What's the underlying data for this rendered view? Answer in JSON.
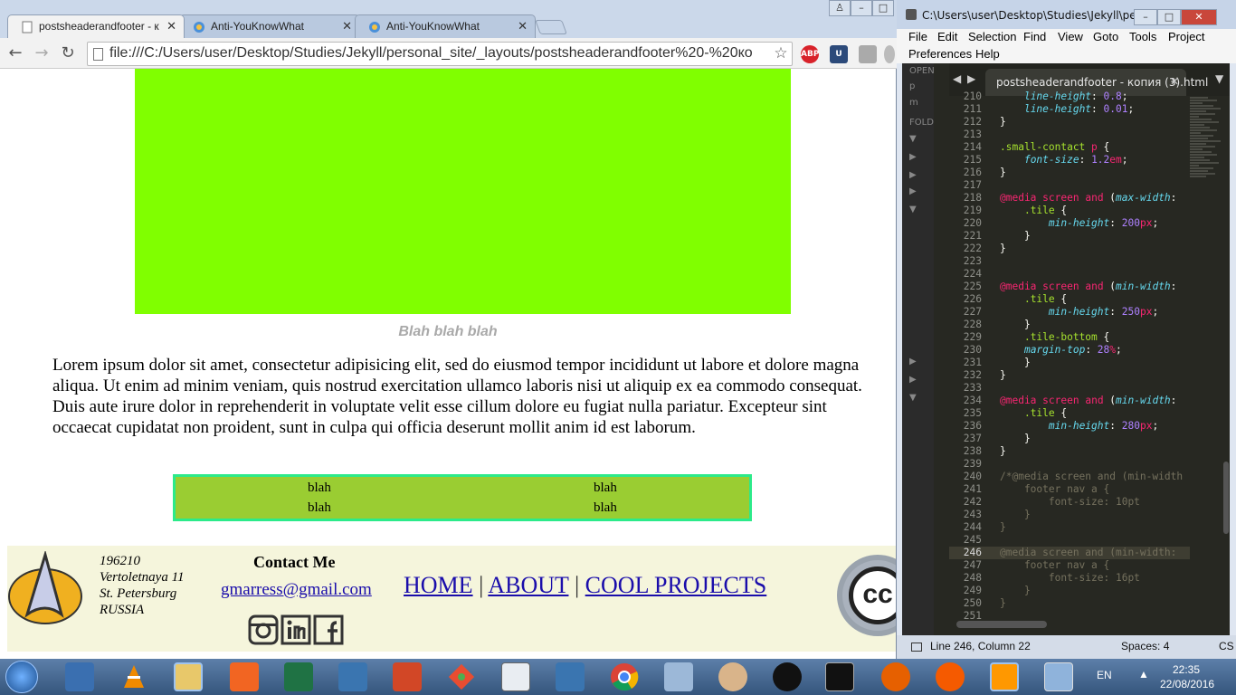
{
  "chrome": {
    "tabs": [
      {
        "title": "postsheaderandfooter - к",
        "close": "✕"
      },
      {
        "title": "Anti-YouKnowWhat",
        "close": "✕"
      },
      {
        "title": "Anti-YouKnowWhat",
        "close": "✕"
      }
    ],
    "address": "file:///C:/Users/user/Desktop/Studies/Jekyll/personal_site/_layouts/postsheaderandfooter%20-%20ко",
    "ext_abp": "ABP",
    "ext_u": "U"
  },
  "page": {
    "hero_color": "#80ff00",
    "caption": "Blah blah blah",
    "lorem": "Lorem ipsum dolor sit amet, consectetur adipisicing elit, sed do eiusmod tempor incididunt ut labore et dolore magna aliqua. Ut enim ad minim veniam, quis nostrud exercitation ullamco laboris nisi ut aliquip ex ea commodo consequat. Duis aute irure dolor in reprehenderit in voluptate velit esse cillum dolore eu fugiat nulla pariatur. Excepteur sint occaecat cupidatat non proident, sunt in culpa qui officia deserunt mollit anim id est laborum.",
    "table": [
      [
        "blah",
        "blah"
      ],
      [
        "blah",
        "blah"
      ]
    ],
    "footer": {
      "address": [
        "196210",
        "Vertoletnaya 11",
        "St. Petersburg",
        "RUSSIA"
      ],
      "contact_title": "Contact Me",
      "email": "gmarress@gmail.com",
      "nav": {
        "home": "HOME",
        "about": "ABOUT",
        "projects": "COOL PROJECTS",
        "sep": "|"
      },
      "cc": "cc"
    }
  },
  "sublime": {
    "title": "C:\\Users\\user\\Desktop\\Studies\\Jekyll\\perso...",
    "menu": [
      "File",
      "Edit",
      "Selection",
      "Find",
      "View",
      "Goto",
      "Tools",
      "Project",
      "Preferences",
      "Help"
    ],
    "sidebar": {
      "open": "OPEN",
      "folders": "FOLD",
      "p": "p",
      "m": "m"
    },
    "tab": "postsheaderandfooter - копия (3).html",
    "status": {
      "position": "Line 246, Column 22",
      "spaces": "Spaces: 4",
      "syntax": "CS"
    }
  },
  "taskbar": {
    "lang": "EN",
    "time": "22:35",
    "date": "22/08/2016"
  }
}
